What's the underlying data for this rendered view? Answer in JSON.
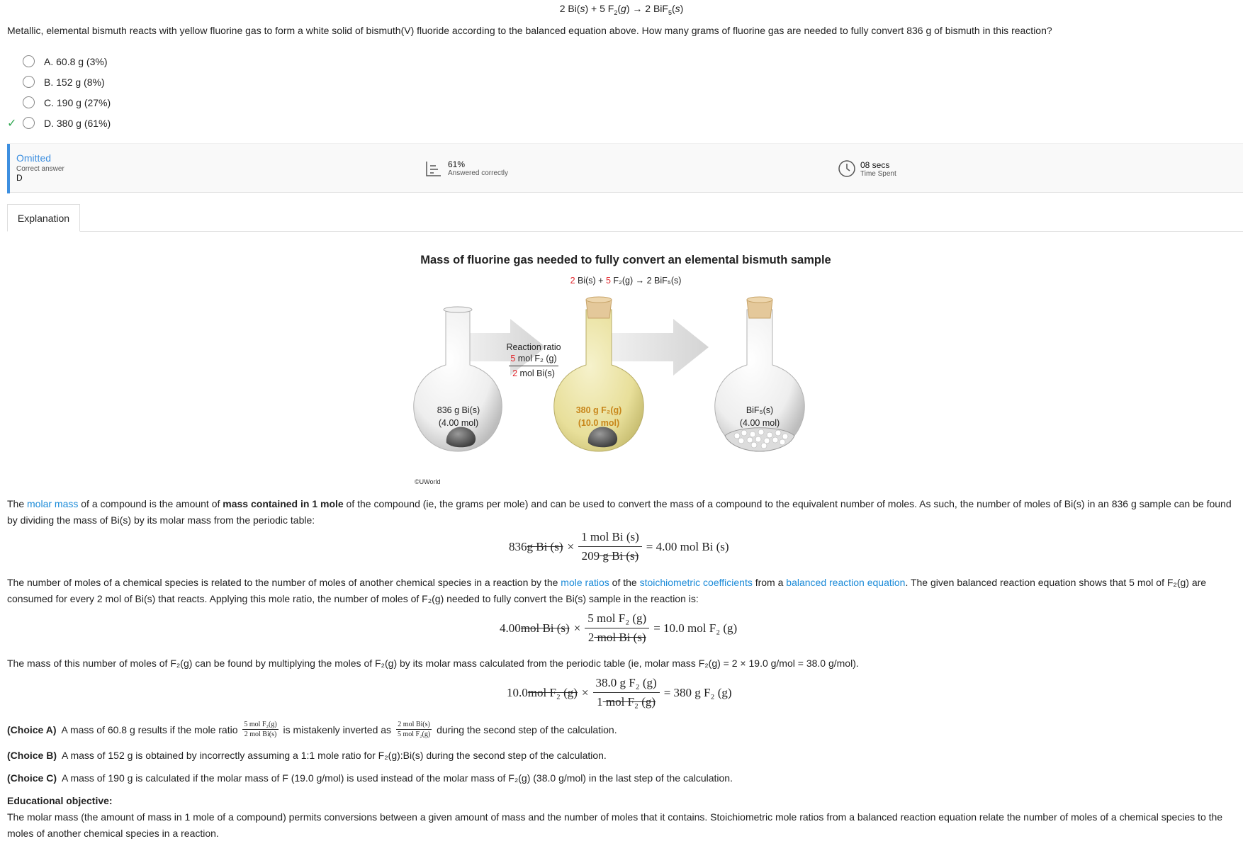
{
  "question": {
    "equation_parts": [
      "2 Bi(",
      "s",
      ") + 5 F",
      "2",
      "(",
      "g",
      ") → 2 BiF",
      "5",
      "(",
      "s",
      ")"
    ],
    "stem": "Metallic, elemental bismuth reacts with yellow fluorine gas to form a white solid of bismuth(V) fluoride according to the balanced equation above.  How many grams of fluorine gas are needed to fully convert 836 g of bismuth in this reaction?",
    "choices": [
      {
        "label": "A.  60.8 g  (3%)",
        "correct": false
      },
      {
        "label": "B.  152 g  (8%)",
        "correct": false
      },
      {
        "label": "C.  190 g  (27%)",
        "correct": false
      },
      {
        "label": "D.  380 g  (61%)",
        "correct": true
      }
    ],
    "check_mark": "✓"
  },
  "stats": {
    "status": "Omitted",
    "correct_answer_label": "Correct answer",
    "correct_answer": "D",
    "percent": "61%",
    "percent_label": "Answered correctly",
    "time": "08 secs",
    "time_label": "Time Spent"
  },
  "tabs": {
    "explanation": "Explanation"
  },
  "figure": {
    "title": "Mass of fluorine gas needed to fully convert an elemental bismuth sample",
    "equation": {
      "c1": "2",
      "t1": " Bi(s) + ",
      "c2": "5",
      "t2": " F₂(g) → 2 BiF₅(s)"
    },
    "ratio_title": "Reaction ratio",
    "ratio_num_coef": "5",
    "ratio_num": " mol F₂ (g)",
    "ratio_den_coef": "2",
    "ratio_den": " mol Bi(s)",
    "flask1_line1": "836 g Bi(s)",
    "flask1_line2": "(4.00 mol)",
    "flask2_line1": "380 g F₂(g)",
    "flask2_line2": "(10.0 mol)",
    "flask3_line1": "BiF₅(s)",
    "flask3_line2": "(4.00 mol)",
    "copyright": "©UWorld",
    "colors": {
      "gas": "#e8df9a",
      "label_orange": "#c8861a",
      "cork": "#e4c89a",
      "red": "#e0242a"
    }
  },
  "explanation": {
    "p1": {
      "t1": "The ",
      "link1": "molar mass",
      "t2": " of a compound is the amount of ",
      "bold1": "mass contained in 1 mole",
      "t3": " of the compound (ie, the grams per mole) and can be used to convert the mass of a compound to the equivalent number of moles.  As such, the number of moles of Bi(s) in an 836 g sample can be found by dividing the mass of Bi(s) by its molar mass from the periodic table:"
    },
    "eq1": {
      "lead": "836",
      "lead_unit": " g Bi (s)",
      "times": "×",
      "num": "1 mol Bi (s)",
      "den_num": "209",
      "den_unit": " g Bi (s)",
      "result": "= 4.00 mol Bi (s)"
    },
    "p2": {
      "t1": "The number of moles of a chemical species is related to the number of moles of another chemical species in a reaction by the ",
      "link1": "mole ratios",
      "t2": " of the ",
      "link2": "stoichiometric coefficients",
      "t3": " from a ",
      "link3": "balanced reaction equation",
      "t4": ".  The given balanced reaction equation shows that 5 mol of F₂(g) are consumed for every 2 mol of Bi(s) that reacts.  Applying this mole ratio, the number of moles of F₂(g) needed to fully convert the Bi(s) sample in the reaction is:"
    },
    "eq2": {
      "lead": "4.00",
      "lead_unit": " mol Bi (s)",
      "times": "×",
      "num": "5 mol F₂ (g)",
      "den_num": "2",
      "den_unit": " mol Bi (s)",
      "result": "= 10.0 mol F₂ (g)"
    },
    "p3": "The mass of this number of moles of F₂(g) can be found by multiplying the moles of F₂(g) by its molar mass calculated from the periodic table (ie, molar mass F₂(g) = 2 × 19.0 g/mol = 38.0 g/mol).",
    "eq3": {
      "lead": "10.0",
      "lead_unit": " mol F₂ (g)",
      "times": "×",
      "num": "38.0 g F₂ (g)",
      "den_num": "1",
      "den_unit": " mol F₂ (g)",
      "result": "= 380 g F₂ (g)"
    },
    "choiceA": {
      "tag": "(Choice A)",
      "t1": "  A mass of 60.8 g results if the mole ratio ",
      "f1_num": "5 mol F₂(g)",
      "f1_den": "2 mol Bi(s)",
      "t2": " is mistakenly inverted as ",
      "f2_num": "2 mol Bi(s)",
      "f2_den": "5 mol F₂(g)",
      "t3": " during the second step of the calculation."
    },
    "choiceB": {
      "tag": "(Choice B)",
      "text": "  A mass of 152 g is obtained by incorrectly assuming a 1:1 mole ratio for F₂(g):Bi(s) during the second step of the calculation."
    },
    "choiceC": {
      "tag": "(Choice C)",
      "text": "  A mass of 190 g is calculated if the molar mass of F (19.0 g/mol) is used instead of the molar mass of F₂(g) (38.0 g/mol) in the last step of the calculation."
    },
    "objective_title": "Educational objective:",
    "objective_text": "The molar mass (the amount of mass in 1 mole of a compound) permits conversions between a given amount of mass and the number of moles that it contains.  Stoichiometric mole ratios from a balanced reaction equation relate the number of moles of a chemical species to the moles of another chemical species in a reaction."
  }
}
